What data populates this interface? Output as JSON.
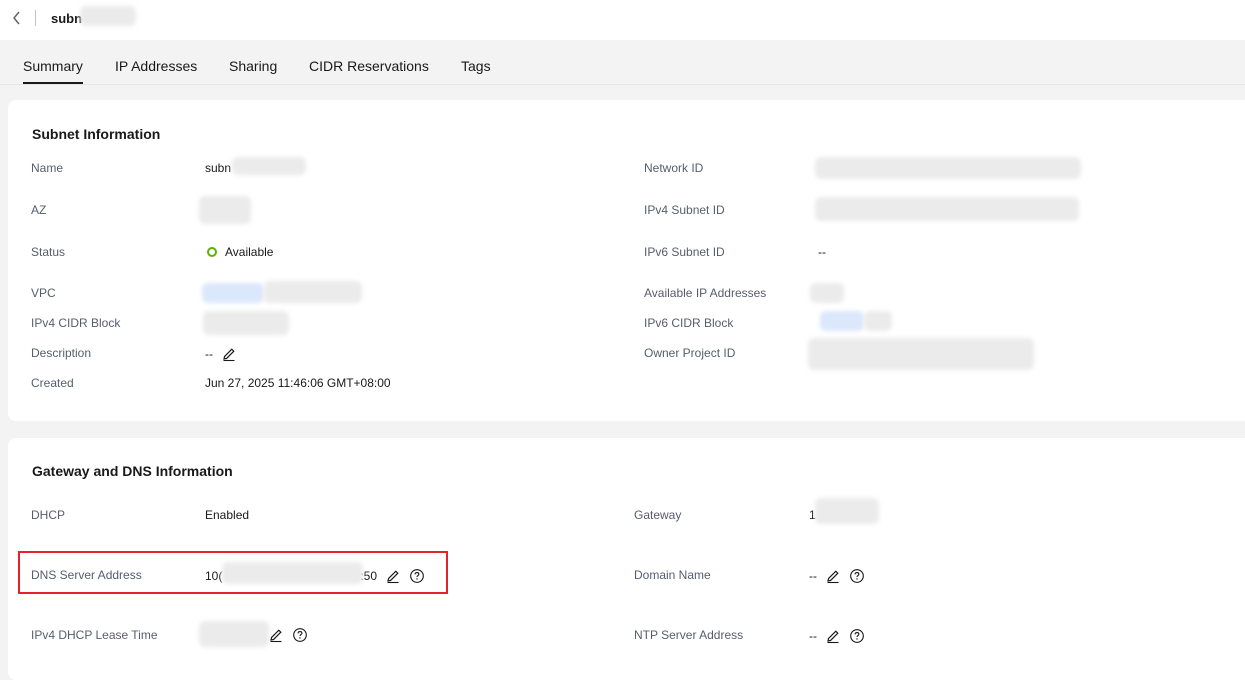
{
  "header": {
    "title": "subn"
  },
  "tabs": [
    {
      "label": "Summary",
      "active": true
    },
    {
      "label": "IP Addresses"
    },
    {
      "label": "Sharing"
    },
    {
      "label": "CIDR Reservations"
    },
    {
      "label": "Tags"
    }
  ],
  "subnet_info": {
    "title": "Subnet Information",
    "name_label": "Name",
    "name_value": "subn",
    "az_label": "AZ",
    "status_label": "Status",
    "status_value": "Available",
    "vpc_label": "VPC",
    "ipv4_cidr_label": "IPv4 CIDR Block",
    "description_label": "Description",
    "description_value": "--",
    "created_label": "Created",
    "created_value": "Jun 27, 2025 11:46:06 GMT+08:00",
    "network_id_label": "Network ID",
    "ipv4_subnet_id_label": "IPv4 Subnet ID",
    "ipv6_subnet_id_label": "IPv6 Subnet ID",
    "ipv6_subnet_id_value": "--",
    "available_ips_label": "Available IP Addresses",
    "ipv6_cidr_label": "IPv6 CIDR Block",
    "owner_project_label": "Owner Project ID"
  },
  "gateway_dns": {
    "title": "Gateway and DNS Information",
    "dhcp_label": "DHCP",
    "dhcp_value": "Enabled",
    "dns_label": "DNS Server Address",
    "dns_value_prefix": "10(",
    "dns_value_suffix": ":50",
    "lease_label": "IPv4 DHCP Lease Time",
    "gateway_label": "Gateway",
    "gateway_value_prefix": "1",
    "domain_label": "Domain Name",
    "domain_value": "--",
    "ntp_label": "NTP Server Address",
    "ntp_value": "--"
  },
  "colors": {
    "status_ok": "#5cb300",
    "highlight": "#e3222c",
    "accent": "#191919"
  }
}
